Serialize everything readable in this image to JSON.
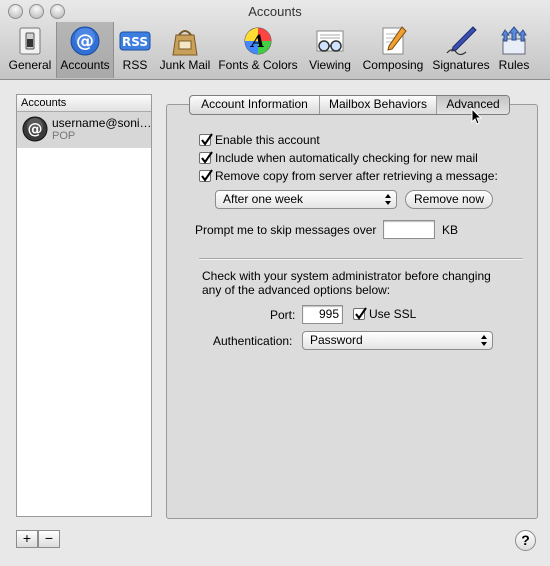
{
  "window": {
    "title": "Accounts"
  },
  "toolbar": {
    "items": [
      {
        "label": "General",
        "icon": "general-switch-icon"
      },
      {
        "label": "Accounts",
        "icon": "at-sign-icon",
        "selected": true
      },
      {
        "label": "RSS",
        "icon": "rss-icon"
      },
      {
        "label": "Junk Mail",
        "icon": "junk-mail-bag-icon"
      },
      {
        "label": "Fonts & Colors",
        "icon": "fonts-colors-icon"
      },
      {
        "label": "Viewing",
        "icon": "viewing-glasses-icon"
      },
      {
        "label": "Composing",
        "icon": "composing-pencil-icon"
      },
      {
        "label": "Signatures",
        "icon": "signature-pen-icon"
      },
      {
        "label": "Rules",
        "icon": "rules-arrows-icon"
      }
    ]
  },
  "accounts": {
    "header": "Accounts",
    "items": [
      {
        "name": "username@soni…",
        "type": "POP",
        "selected": true
      }
    ],
    "add_label": "+",
    "remove_label": "−"
  },
  "tabs": [
    {
      "label": "Account Information",
      "selected": false
    },
    {
      "label": "Mailbox Behaviors",
      "selected": false
    },
    {
      "label": "Advanced",
      "selected": true
    }
  ],
  "advanced": {
    "enable_account": {
      "label": "Enable this account",
      "checked": true
    },
    "include_check": {
      "label": "Include when automatically checking for new mail",
      "checked": true
    },
    "remove_copy": {
      "label": "Remove copy from server after retrieving a message:",
      "checked": true
    },
    "remove_after": {
      "selected": "After one week"
    },
    "remove_now_label": "Remove now",
    "prompt_label": "Prompt me to skip messages over",
    "prompt_value": "",
    "prompt_unit": "KB",
    "admin_note_line1": "Check with your system administrator before changing",
    "admin_note_line2": "any of the advanced options below:",
    "port_label": "Port:",
    "port_value": "995",
    "use_ssl": {
      "label": "Use SSL",
      "checked": true
    },
    "auth_label": "Authentication:",
    "auth_selected": "Password"
  },
  "help_label": "?",
  "colors": {
    "accent_blue": "#2f6fd6",
    "selection_gray": "#d7d7d7"
  }
}
